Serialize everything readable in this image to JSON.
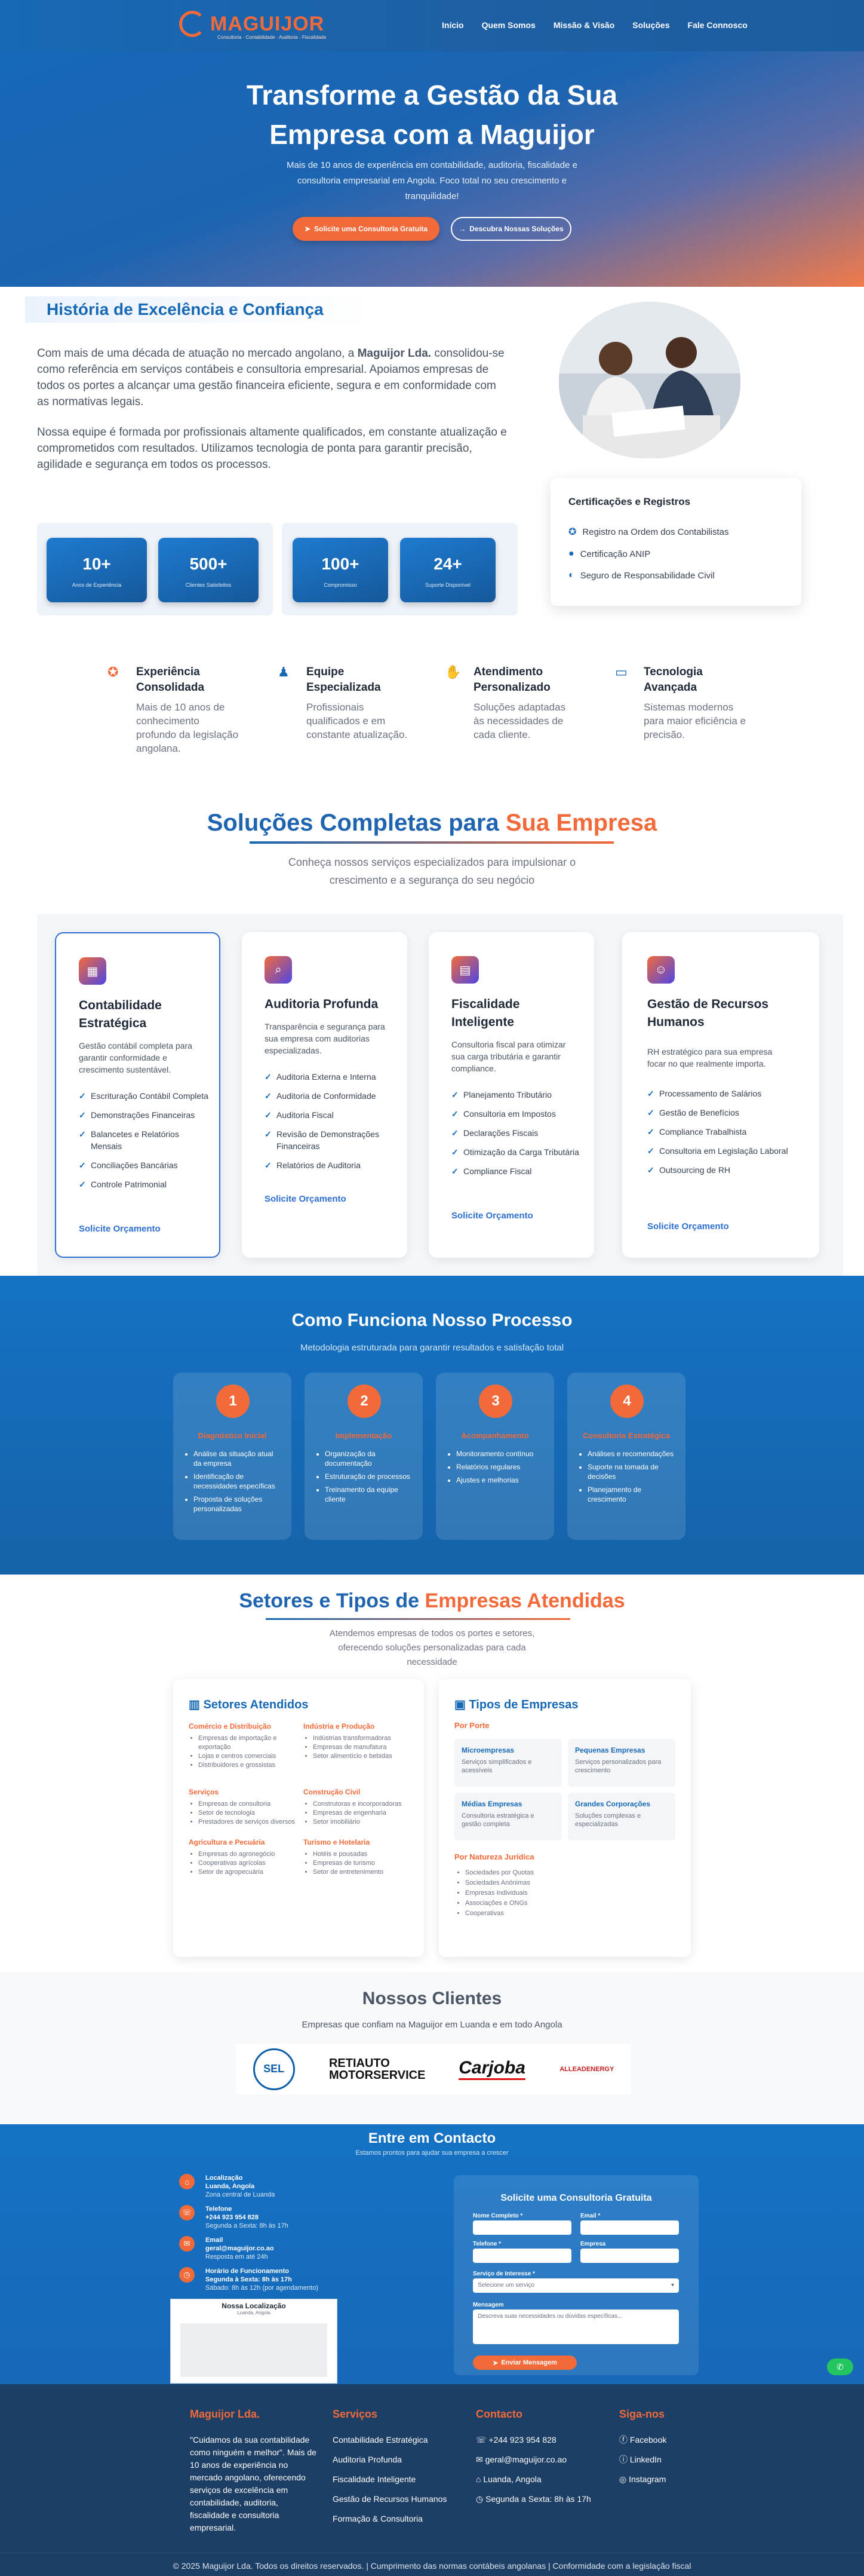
{
  "nav": {
    "brand": "MAGUIJOR",
    "tagline": "Consultoria · Contabilidade · Auditoria · Fiscalidade",
    "links": [
      "Início",
      "Quem Somos",
      "Missão & Visão",
      "Soluções",
      "Fale Connosco"
    ]
  },
  "hero": {
    "title_line1": "Transforme a Gestão da Sua",
    "title_line2": "Empresa com a Maguijor",
    "text": "Mais de 10 anos de experiência em contabilidade, auditoria, fiscalidade e consultoria empresarial em Angola. Foco total no seu crescimento e tranquilidade!",
    "cta_primary": "Solicite uma Consultoria Gratuita",
    "cta_secondary": "Descubra Nossas Soluções"
  },
  "history": {
    "title": "História de Excelência e Confiança",
    "p1_before": "Com mais de uma década de atuação no mercado angolano, a ",
    "p1_bold": "Maguijor Lda.",
    "p1_after": " consolidou-se como referência em serviços contábeis e consultoria empresarial. Apoiamos empresas de todos os portes a alcançar uma gestão financeira eficiente, segura e em conformidade com as normativas legais.",
    "p2": "Nossa equipe é formada por profissionais altamente qualificados, em constante atualização e comprometidos com resultados. Utilizamos tecnologia de ponta para garantir precisão, agilidade e segurança em todos os processos.",
    "stats": [
      {
        "value": "10+",
        "label": "Anos de Experiência"
      },
      {
        "value": "500+",
        "label": "Clientes Satisfeitos"
      },
      {
        "value": "100+",
        "label": "Compromisso"
      },
      {
        "value": "24+",
        "label": "Suporte Disponível"
      }
    ],
    "cert_title": "Certificações e Registros",
    "certs": [
      "Registro na Ordem dos Contabilistas",
      "Certificação ANIP",
      "Seguro de Responsabilidade Civil"
    ]
  },
  "features": [
    {
      "icon": "award-icon",
      "title": "Experiência Consolidada",
      "text": "Mais de 10 anos de conhecimento profundo da legislação angolana."
    },
    {
      "icon": "team-icon",
      "title": "Equipe Especializada",
      "text": "Profissionais qualificados e em constante atualização."
    },
    {
      "icon": "handshake-icon",
      "title": "Atendimento Personalizado",
      "text": "Soluções adaptadas às necessidades de cada cliente."
    },
    {
      "icon": "monitor-icon",
      "title": "Tecnologia Avançada",
      "text": "Sistemas modernos para maior eficiência e precisão."
    }
  ],
  "solutions": {
    "title_a": "Soluções Completas para ",
    "title_b": "Sua Empresa",
    "subtitle": "Conheça nossos serviços especializados para impulsionar o crescimento e a segurança do seu negócio",
    "cards": [
      {
        "icon": "calculator-icon",
        "title": "Contabilidade Estratégica",
        "desc": "Gestão contábil completa para garantir conformidade e crescimento sustentável.",
        "items": [
          "Escrituração Contábil Completa",
          "Demonstrações Financeiras",
          "Balancetes e Relatórios Mensais",
          "Conciliações Bancárias",
          "Controle Patrimonial"
        ],
        "link": "Solicite Orçamento"
      },
      {
        "icon": "search-icon",
        "title": "Auditoria Profunda",
        "desc": "Transparência e segurança para sua empresa com auditorias especializadas.",
        "items": [
          "Auditoria Externa e Interna",
          "Auditoria de Conformidade",
          "Auditoria Fiscal",
          "Revisão de Demonstrações Financeiras",
          "Relatórios de Auditoria"
        ],
        "link": "Solicite Orçamento"
      },
      {
        "icon": "document-icon",
        "title": "Fiscalidade Inteligente",
        "desc": "Consultoria fiscal para otimizar sua carga tributária e garantir compliance.",
        "items": [
          "Planejamento Tributário",
          "Consultoria em Impostos",
          "Declarações Fiscais",
          "Otimização da Carga Tributária",
          "Compliance Fiscal"
        ],
        "link": "Solicite Orçamento"
      },
      {
        "icon": "people-icon",
        "title": "Gestão de Recursos Humanos",
        "desc": "RH estratégico para sua empresa focar no que realmente importa.",
        "items": [
          "Processamento de Salários",
          "Gestão de Benefícios",
          "Compliance Trabalhista",
          "Consultoria em Legislação Laboral",
          "Outsourcing de RH"
        ],
        "link": "Solicite Orçamento"
      }
    ]
  },
  "process": {
    "title": "Como Funciona Nosso Processo",
    "subtitle": "Metodologia estruturada para garantir resultados e satisfação total",
    "steps": [
      {
        "n": "1",
        "title": "Diagnóstico Inicial",
        "items": [
          "Análise da situação atual da empresa",
          "Identificação de necessidades específicas",
          "Proposta de soluções personalizadas"
        ]
      },
      {
        "n": "2",
        "title": "Implementação",
        "items": [
          "Organização da documentação",
          "Estruturação de processos",
          "Treinamento da equipe cliente"
        ]
      },
      {
        "n": "3",
        "title": "Acompanhamento",
        "items": [
          "Monitoramento contínuo",
          "Relatórios regulares",
          "Ajustes e melhorias"
        ]
      },
      {
        "n": "4",
        "title": "Consultoria Estratégica",
        "items": [
          "Análises e recomendações",
          "Suporte na tomada de decisões",
          "Planejamento de crescimento"
        ]
      }
    ]
  },
  "sectors": {
    "title_a": "Setores e Tipos de ",
    "title_b": "Empresas Atendidas",
    "subtitle": "Atendemos empresas de todos os portes e setores, oferecendo soluções personalizadas para cada necessidade",
    "left_title": "Setores Atendidos",
    "groups": [
      {
        "title": "Comércio e Distribuição",
        "items": [
          "Empresas de importação e exportação",
          "Lojas e centros comerciais",
          "Distribuidores e grossistas"
        ]
      },
      {
        "title": "Indústria e Produção",
        "items": [
          "Indústrias transformadoras",
          "Empresas de manufatura",
          "Setor alimentício e bebidas"
        ]
      },
      {
        "title": "Serviços",
        "items": [
          "Empresas de consultoria",
          "Setor de tecnologia",
          "Prestadores de serviços diversos"
        ]
      },
      {
        "title": "Construção Civil",
        "items": [
          "Construtoras e incorporadoras",
          "Empresas de engenharia",
          "Setor imobiliário"
        ]
      },
      {
        "title": "Agricultura e Pecuária",
        "items": [
          "Empresas do agronegócio",
          "Cooperativas agrícolas",
          "Setor de agropecuária"
        ]
      },
      {
        "title": "Turismo e Hotelaria",
        "items": [
          "Hotéis e pousadas",
          "Empresas de turismo",
          "Setor de entretenimento"
        ]
      }
    ],
    "right_title": "Tipos de Empresas",
    "by_size": "Por Porte",
    "sizes": [
      {
        "title": "Microempresas",
        "text": "Serviços simplificados e acessíveis"
      },
      {
        "title": "Pequenas Empresas",
        "text": "Serviços personalizados para crescimento"
      },
      {
        "title": "Médias Empresas",
        "text": "Consultoria estratégica e gestão completa"
      },
      {
        "title": "Grandes Corporações",
        "text": "Soluções complexas e especializadas"
      }
    ],
    "by_legal": "Por Natureza Jurídica",
    "legal": [
      "Sociedades por Quotas",
      "Sociedades Anónimas",
      "Empresas Individuais",
      "Associações e ONGs",
      "Cooperativas"
    ]
  },
  "clients": {
    "title": "Nossos Clientes",
    "subtitle": "Empresas que confiam na Maguijor em Luanda e em todo Angola",
    "logos": [
      "SEL",
      "RETIAUTO MOTORSERVICE",
      "Carjoba",
      "ALLEADENERGY"
    ]
  },
  "contact": {
    "title": "Entre em Contacto",
    "subtitle": "Estamos prontos para ajudar sua empresa a crescer",
    "info": [
      {
        "icon": "location-icon",
        "label": "Localização",
        "value": "Luanda, Angola",
        "note": "Zona central de Luanda"
      },
      {
        "icon": "phone-icon",
        "label": "Telefone",
        "value": "+244 923 954 828",
        "note": "Segunda a Sexta: 8h às 17h"
      },
      {
        "icon": "mail-icon",
        "label": "Email",
        "value": "geral@maguijor.co.ao",
        "note": "Resposta em até 24h"
      },
      {
        "icon": "clock-icon",
        "label": "Horário de Funcionamento",
        "value": "Segunda à Sexta: 8h às 17h",
        "note": "Sábado: 8h às 12h (por agendamento)"
      }
    ],
    "map_title": "Nossa Localização",
    "map_sub": "Luanda, Angola",
    "form_title": "Solicite uma Consultoria Gratuita",
    "f_name": "Nome Completo *",
    "f_email": "Email *",
    "f_phone": "Telefone *",
    "f_company": "Empresa",
    "f_service": "Serviço de Interesse *",
    "f_service_value": "Selecione um serviço",
    "f_message": "Mensagem",
    "f_message_ph": "Descreva suas necessidades ou dúvidas específicas...",
    "f_submit": "Enviar Mensagem"
  },
  "footer": {
    "brand": "Maguijor Lda.",
    "about": "\"Cuidamos da sua contabilidade como ninguém e melhor\". Mais de 10 anos de experiência no mercado angolano, oferecendo serviços de excelência em contabilidade, auditoria, fiscalidade e consultoria empresarial.",
    "services_title": "Serviços",
    "services": [
      "Contabilidade Estratégica",
      "Auditoria Profunda",
      "Fiscalidade Inteligente",
      "Gestão de Recursos Humanos",
      "Formação & Consultoria"
    ],
    "contact_title": "Contacto",
    "contacts": [
      "+244 923 954 828",
      "geral@maguijor.co.ao",
      "Luanda, Angola",
      "Segunda a Sexta: 8h às 17h"
    ],
    "social_title": "Siga-nos",
    "social": [
      "Facebook",
      "LinkedIn",
      "Instagram"
    ],
    "copyright": "© 2025 Maguijor Lda. Todos os direitos reservados. | Cumprimento das normas contábeis angolanas | Conformidade com a legislação fiscal"
  },
  "colors": {
    "primary": "#1769b5",
    "accent": "#f26a3a",
    "footer": "#1d3f66"
  }
}
